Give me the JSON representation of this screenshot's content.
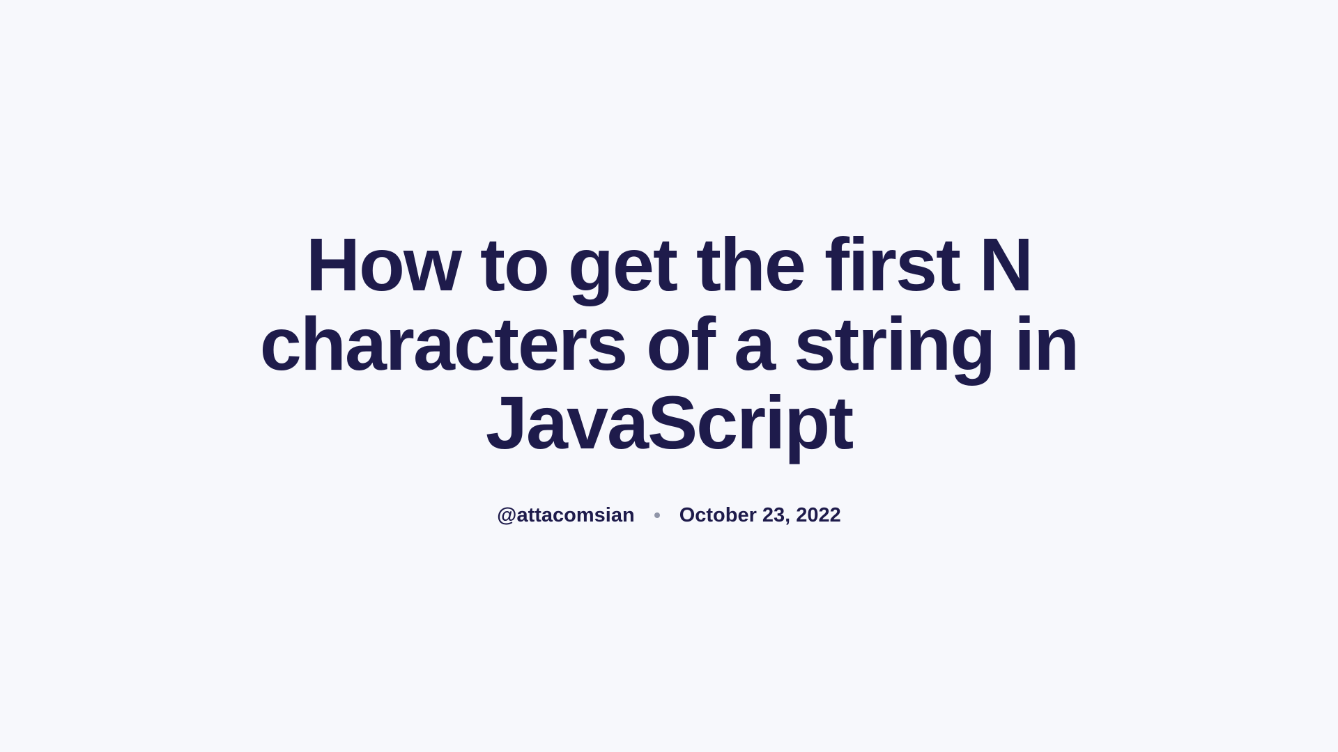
{
  "article": {
    "title": "How to get the first N characters of a string in JavaScript",
    "author": "@attacomsian",
    "date": "October 23, 2022"
  }
}
